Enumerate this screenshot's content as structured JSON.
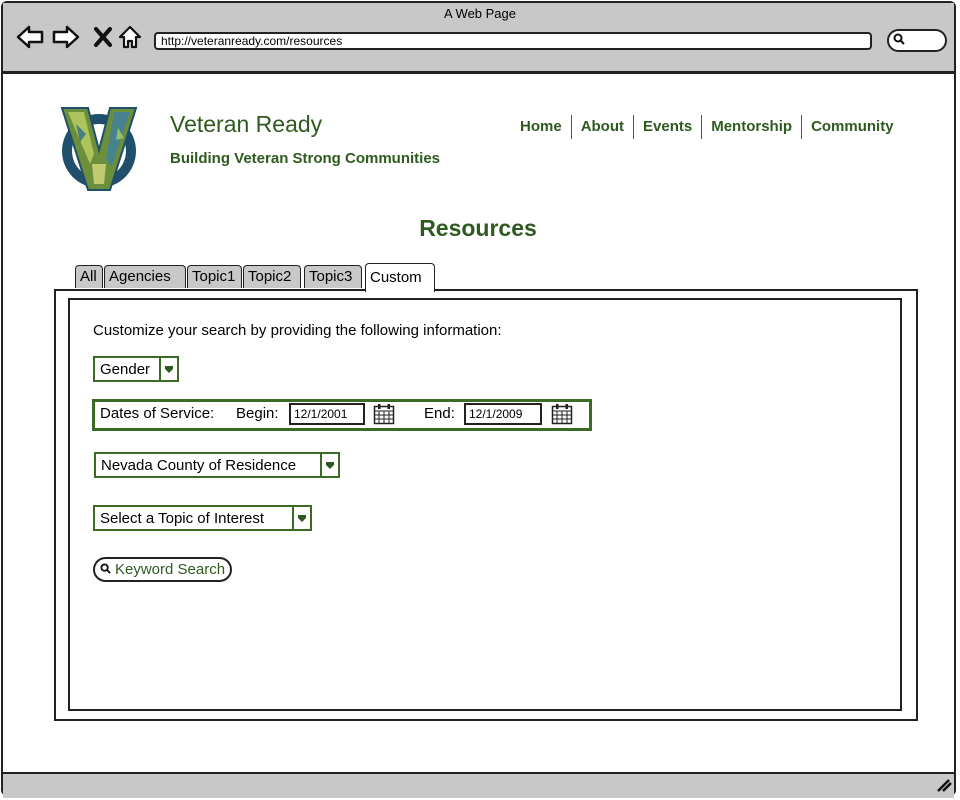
{
  "browser": {
    "window_title": "A Web Page",
    "url": "http://veteranready.com/resources",
    "icons": [
      "back-arrow-icon",
      "forward-arrow-icon",
      "close-icon",
      "home-icon",
      "search-icon",
      "resize-grip-icon"
    ]
  },
  "site": {
    "title": "Veteran Ready",
    "tagline": "Building Veteran Strong Communities",
    "logo_icon": "v-logo-icon"
  },
  "nav": {
    "items": [
      "Home",
      "About",
      "Events",
      "Mentorship",
      "Community"
    ]
  },
  "page": {
    "heading": "Resources"
  },
  "tabs": {
    "items": [
      "All",
      "Agencies",
      "Topic1",
      "Topic2",
      "Topic3",
      "Custom"
    ],
    "selected": "Custom"
  },
  "form": {
    "instruction": "Customize your search by providing the following information:",
    "gender_label": "Gender",
    "dates_label": "Dates of Service:",
    "begin_label": "Begin:",
    "begin_value": "12/1/2001",
    "end_label": "End:",
    "end_value": "12/1/2009",
    "county_label": "Nevada County of Residence",
    "topic_label": "Select a Topic of Interest",
    "keyword_button_label": "Keyword Search"
  },
  "colors": {
    "accent_green": "#2f5a1f",
    "field_border_green": "#3b6b25",
    "chrome_gray": "#c8c8c8"
  }
}
